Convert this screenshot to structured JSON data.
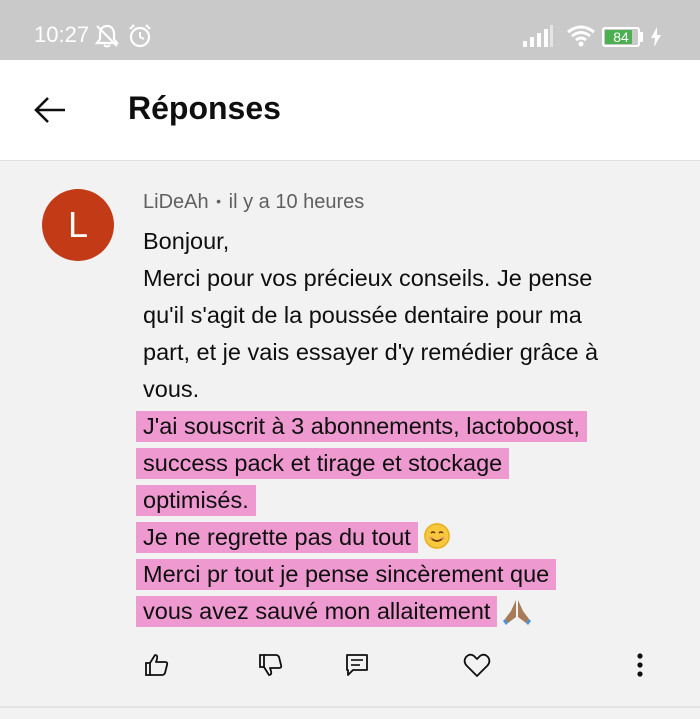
{
  "status_bar": {
    "time": "10:27",
    "battery_level": "84",
    "battery_percent": 84,
    "icons": [
      "notifications-off-icon",
      "alarm-icon",
      "signal-icon",
      "wifi-icon",
      "battery-icon",
      "charging-icon"
    ]
  },
  "header": {
    "back_icon": "arrow-left-icon",
    "title": "Réponses"
  },
  "comment": {
    "avatar_letter": "L",
    "avatar_color": "#c33b16",
    "author": "LiDeAh",
    "separator": "•",
    "time_ago": "il y a 10 heures",
    "lines": [
      "Bonjour,",
      "Merci pour vos précieux conseils. Je pense",
      "qu'il s'agit de la poussée dentaire pour ma",
      "part, et je vais essayer d'y remédier grâce à",
      "vous."
    ],
    "highlighted_lines": [
      "J'ai souscrit à 3 abonnements, lactoboost,",
      "success pack et tirage et stockage",
      "optimisés.",
      "Je ne regrette pas du tout",
      "Merci pr tout je pense sincèrement que",
      "vous avez sauvé mon allaitement"
    ],
    "highlight_color": "#ee9ad0",
    "emojis": [
      "smiling-face-emoji",
      "folded-hands-emoji"
    ]
  },
  "actions": {
    "icons": [
      "thumbs-up-icon",
      "thumbs-down-icon",
      "reply-icon",
      "heart-icon",
      "more-vertical-icon"
    ]
  }
}
